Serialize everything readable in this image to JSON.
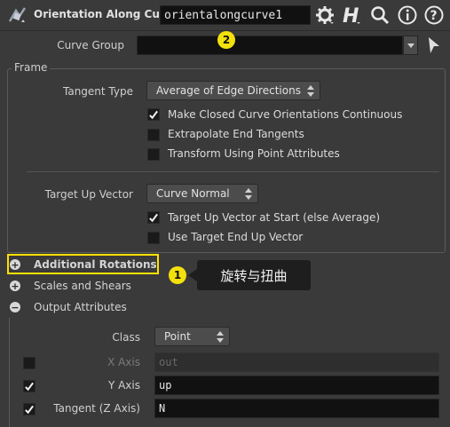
{
  "header": {
    "node_type": "Orientation Along Curve",
    "node_name": "orientalongcurve1",
    "badge_2": "2"
  },
  "curve_group": {
    "label": "Curve Group",
    "value": ""
  },
  "frame": {
    "title": "Frame",
    "tangent_type": {
      "label": "Tangent Type",
      "value": "Average of Edge Directions"
    },
    "make_closed": {
      "label": "Make Closed Curve Orientations Continuous",
      "checked": true
    },
    "extrapolate": {
      "label": "Extrapolate End Tangents",
      "checked": false
    },
    "transform_point": {
      "label": "Transform Using Point Attributes",
      "checked": false
    },
    "target_up_vector": {
      "label": "Target Up Vector",
      "value": "Curve Normal"
    },
    "up_at_start": {
      "label": "Target Up Vector at Start (else Average)",
      "checked": true
    },
    "use_end_up": {
      "label": "Use Target End Up Vector",
      "checked": false
    }
  },
  "folders": {
    "additional_rotations": "Additional Rotations",
    "scales_and_shears": "Scales and Shears",
    "output_attributes": "Output Attributes"
  },
  "annotation": {
    "badge_1": "1",
    "tooltip": "旋转与扭曲",
    "highlight_color": "#ffe000"
  },
  "output": {
    "class": {
      "label": "Class",
      "value": "Point"
    },
    "x_axis": {
      "label": "X Axis",
      "value": "out",
      "checked": false
    },
    "y_axis": {
      "label": "Y Axis",
      "value": "up",
      "checked": true
    },
    "tangent": {
      "label": "Tangent (Z Axis)",
      "value": "N",
      "checked": true
    }
  }
}
